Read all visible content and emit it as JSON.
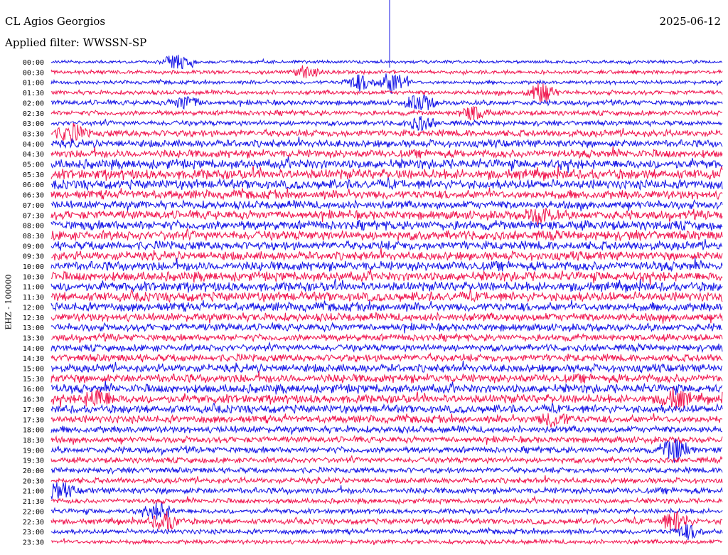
{
  "header": {
    "station": "CL Agios Georgios",
    "date": "2025-06-12",
    "filter": "Applied filter: WWSSN-SP"
  },
  "side_label": "EHZ - 100000",
  "colors": {
    "even_trace": "#1414e6",
    "odd_trace": "#f0144e",
    "marker": "#1414e6"
  },
  "chart_data": {
    "type": "line",
    "title": "CL Agios Georgios",
    "ylabel": "EHZ - 100000",
    "xlabel": "",
    "row_labels": [
      "00:00",
      "00:30",
      "01:00",
      "01:30",
      "02:00",
      "02:30",
      "03:00",
      "03:30",
      "04:00",
      "04:30",
      "05:00",
      "05:30",
      "06:00",
      "06:30",
      "07:00",
      "07:30",
      "08:00",
      "08:30",
      "09:00",
      "09:30",
      "10:00",
      "10:30",
      "11:00",
      "11:30",
      "12:00",
      "12:30",
      "13:00",
      "13:30",
      "14:00",
      "14:30",
      "15:00",
      "15:30",
      "16:00",
      "16:30",
      "17:00",
      "17:30",
      "18:00",
      "18:30",
      "19:00",
      "19:30",
      "20:00",
      "20:30",
      "21:00",
      "21:30",
      "22:00",
      "22:30",
      "23:00",
      "23:30"
    ],
    "row_noise_amplitude": [
      0.25,
      0.3,
      0.3,
      0.35,
      0.4,
      0.4,
      0.4,
      0.55,
      0.6,
      0.65,
      0.75,
      0.8,
      0.75,
      0.7,
      0.65,
      0.7,
      0.75,
      0.75,
      0.7,
      0.7,
      0.75,
      0.75,
      0.75,
      0.75,
      0.7,
      0.65,
      0.6,
      0.55,
      0.55,
      0.6,
      0.65,
      0.7,
      0.7,
      0.7,
      0.65,
      0.6,
      0.55,
      0.5,
      0.5,
      0.45,
      0.45,
      0.45,
      0.5,
      0.4,
      0.4,
      0.45,
      0.4,
      0.35
    ],
    "events": [
      {
        "row": 0,
        "pos": 0.19,
        "amp": 1.4
      },
      {
        "row": 1,
        "pos": 0.38,
        "amp": 0.9
      },
      {
        "row": 2,
        "pos": 0.51,
        "amp": 1.8
      },
      {
        "row": 2,
        "pos": 0.46,
        "amp": 1.2
      },
      {
        "row": 3,
        "pos": 0.73,
        "amp": 1.6
      },
      {
        "row": 4,
        "pos": 0.2,
        "amp": 1.0
      },
      {
        "row": 4,
        "pos": 0.55,
        "amp": 1.3
      },
      {
        "row": 5,
        "pos": 0.63,
        "amp": 1.0
      },
      {
        "row": 6,
        "pos": 0.55,
        "amp": 1.0
      },
      {
        "row": 7,
        "pos": 0.03,
        "amp": 1.2
      },
      {
        "row": 15,
        "pos": 0.73,
        "amp": 1.1
      },
      {
        "row": 33,
        "pos": 0.07,
        "amp": 1.2
      },
      {
        "row": 33,
        "pos": 0.93,
        "amp": 1.4
      },
      {
        "row": 35,
        "pos": 0.75,
        "amp": 1.0
      },
      {
        "row": 38,
        "pos": 0.93,
        "amp": 1.8
      },
      {
        "row": 42,
        "pos": 0.01,
        "amp": 1.2
      },
      {
        "row": 44,
        "pos": 0.16,
        "amp": 1.2
      },
      {
        "row": 45,
        "pos": 0.17,
        "amp": 1.3
      },
      {
        "row": 45,
        "pos": 0.93,
        "amp": 1.5
      },
      {
        "row": 46,
        "pos": 0.95,
        "amp": 1.0
      }
    ]
  }
}
